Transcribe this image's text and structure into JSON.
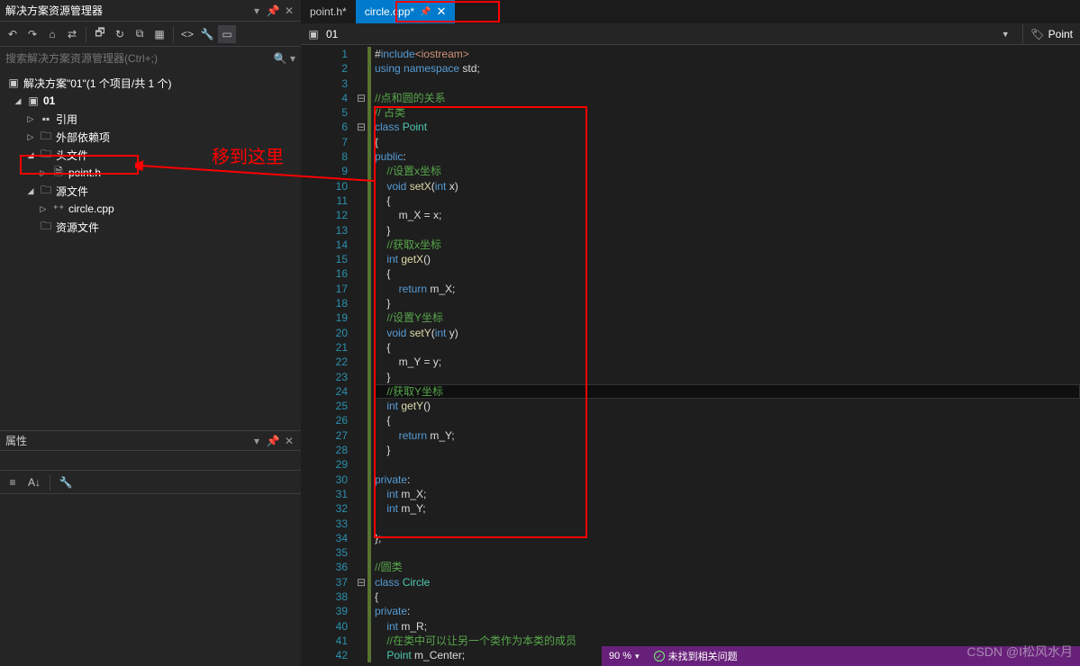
{
  "solution_explorer": {
    "title": "解决方案资源管理器",
    "search_placeholder": "搜索解决方案资源管理器(Ctrl+;)",
    "solution_label": "解决方案\"01\"(1 个项目/共 1 个)",
    "project": "01",
    "nodes": {
      "references": "引用",
      "external_deps": "外部依赖项",
      "headers": "头文件",
      "point_h": "point.h",
      "sources": "源文件",
      "circle_cpp": "circle.cpp",
      "resources": "资源文件"
    }
  },
  "annotation": {
    "move_here": "移到这里"
  },
  "properties": {
    "title": "属性"
  },
  "tabs": {
    "point_h": "point.h*",
    "circle_cpp": "circle.cpp*"
  },
  "context_bar": {
    "scope": "01",
    "class": "Point"
  },
  "code_lines": [
    {
      "n": 1,
      "mod": true,
      "html": "<span class='op'>#</span><span class='kw'>include</span><span class='str'>&lt;iostream&gt;</span>"
    },
    {
      "n": 2,
      "mod": true,
      "html": "<span class='kw'>using namespace</span> std;"
    },
    {
      "n": 3,
      "mod": true,
      "html": ""
    },
    {
      "n": 4,
      "fold": "⊟",
      "mod": true,
      "html": "<span class='cmt'>//点和圆的关系</span>"
    },
    {
      "n": 5,
      "mod": true,
      "html": "<span class='cmt'>// 占类</span>"
    },
    {
      "n": 6,
      "fold": "⊟",
      "mod": true,
      "html": "<span class='kw'>class</span> <span class='type'>Point</span>"
    },
    {
      "n": 7,
      "mod": true,
      "html": "{"
    },
    {
      "n": 8,
      "mod": true,
      "html": "<span class='kw'>public</span>:"
    },
    {
      "n": 9,
      "mod": true,
      "html": "    <span class='cmt'>//设置x坐标</span>"
    },
    {
      "n": 10,
      "mod": true,
      "html": "    <span class='kw'>void</span> <span class='fn'>setX</span>(<span class='kw'>int</span> x)"
    },
    {
      "n": 11,
      "mod": true,
      "html": "    {"
    },
    {
      "n": 12,
      "mod": true,
      "html": "        m_X = x;"
    },
    {
      "n": 13,
      "mod": true,
      "html": "    }"
    },
    {
      "n": 14,
      "mod": true,
      "html": "    <span class='cmt'>//获取x坐标</span>"
    },
    {
      "n": 15,
      "mod": true,
      "html": "    <span class='kw'>int</span> <span class='fn'>getX</span>()"
    },
    {
      "n": 16,
      "mod": true,
      "html": "    {"
    },
    {
      "n": 17,
      "mod": true,
      "html": "        <span class='kw'>return</span> m_X;"
    },
    {
      "n": 18,
      "mod": true,
      "html": "    }"
    },
    {
      "n": 19,
      "mod": true,
      "html": "    <span class='cmt'>//设置Y坐标</span>"
    },
    {
      "n": 20,
      "mod": true,
      "html": "    <span class='kw'>void</span> <span class='fn'>setY</span>(<span class='kw'>int</span> y)"
    },
    {
      "n": 21,
      "mod": true,
      "html": "    {"
    },
    {
      "n": 22,
      "mod": true,
      "html": "        m_Y = y;"
    },
    {
      "n": 23,
      "mod": true,
      "html": "    }"
    },
    {
      "n": 24,
      "mod": true,
      "hl": true,
      "html": "    <span class='cmt'>//获取Y坐标</span>"
    },
    {
      "n": 25,
      "mod": true,
      "html": "    <span class='kw'>int</span> <span class='fn'>getY</span>()"
    },
    {
      "n": 26,
      "mod": true,
      "html": "    {"
    },
    {
      "n": 27,
      "mod": true,
      "html": "        <span class='kw'>return</span> m_Y;"
    },
    {
      "n": 28,
      "mod": true,
      "html": "    }"
    },
    {
      "n": 29,
      "mod": true,
      "html": ""
    },
    {
      "n": 30,
      "mod": true,
      "html": "<span class='kw'>private</span>:"
    },
    {
      "n": 31,
      "mod": true,
      "html": "    <span class='kw'>int</span> m_X;"
    },
    {
      "n": 32,
      "mod": true,
      "html": "    <span class='kw'>int</span> m_Y;"
    },
    {
      "n": 33,
      "mod": true,
      "html": ""
    },
    {
      "n": 34,
      "mod": true,
      "html": "};"
    },
    {
      "n": 35,
      "mod": true,
      "html": ""
    },
    {
      "n": 36,
      "mod": true,
      "html": "<span class='cmt'>//圆类</span>"
    },
    {
      "n": 37,
      "fold": "⊟",
      "mod": true,
      "html": "<span class='kw'>class</span> <span class='type'>Circle</span>"
    },
    {
      "n": 38,
      "mod": true,
      "html": "{"
    },
    {
      "n": 39,
      "mod": true,
      "html": "<span class='kw'>private</span>:"
    },
    {
      "n": 40,
      "mod": true,
      "html": "    <span class='kw'>int</span> m_R;"
    },
    {
      "n": 41,
      "mod": true,
      "html": "    <span class='cmt'>//在类中可以让另一个类作为本类的成员</span>"
    },
    {
      "n": 42,
      "mod": true,
      "html": "    <span class='type'>Point</span> m_Center;"
    }
  ],
  "status": {
    "zoom": "90 %",
    "issues": "未找到相关问题"
  },
  "watermark": "CSDN @I松风水月"
}
